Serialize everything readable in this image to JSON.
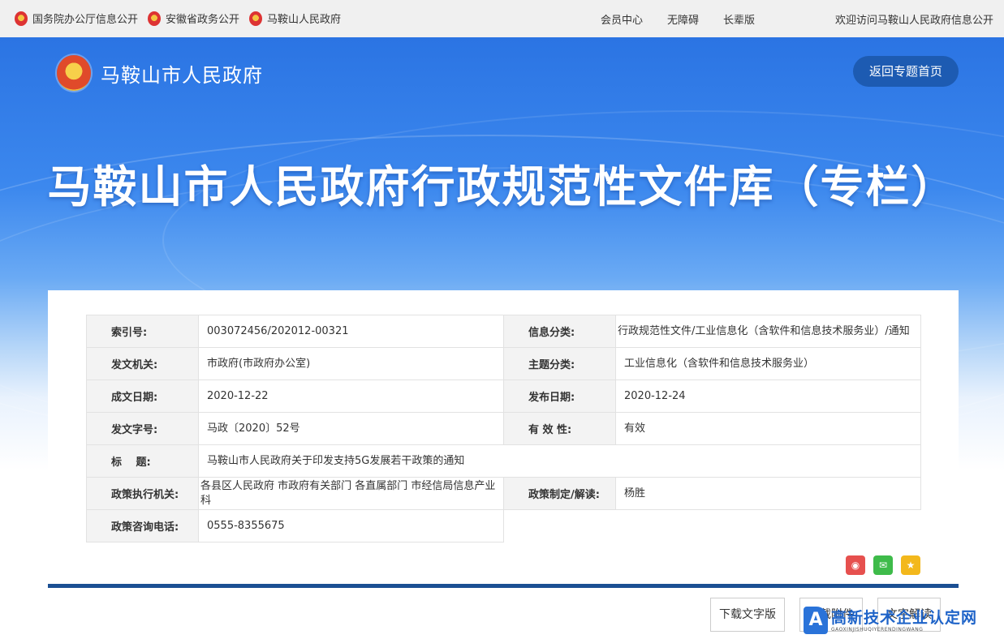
{
  "topbar": {
    "links": [
      "国务院办公厅信息公开",
      "安徽省政务公开",
      "马鞍山人民政府"
    ],
    "nav": [
      "会员中心",
      "无障碍",
      "长辈版"
    ],
    "welcome": "欢迎访问马鞍山人民政府信息公开"
  },
  "header": {
    "site_name": "马鞍山市人民政府",
    "back_button": "返回专题首页",
    "banner_title": "马鞍山市人民政府行政规范性文件库（专栏）"
  },
  "meta": {
    "index_label": "索引号:",
    "index_value": "003072456/202012-00321",
    "info_cat_label": "信息分类:",
    "info_cat_value": "行政规范性文件/工业信息化（含软件和信息技术服务业）/通知",
    "issuer_label": "发文机关:",
    "issuer_value": "市政府(市政府办公室)",
    "topic_label": "主题分类:",
    "topic_value": "工业信息化（含软件和信息技术服务业）",
    "written_label": "成文日期:",
    "written_value": "2020-12-22",
    "published_label": "发布日期:",
    "published_value": "2020-12-24",
    "docno_label": "发文字号:",
    "docno_value": "马政〔2020〕52号",
    "validity_label": "有 效 性:",
    "validity_value": "有效",
    "title_label": "标　 题:",
    "title_value": "马鞍山市人民政府关于印发支持5G发展若干政策的通知",
    "exec_label": "政策执行机关:",
    "exec_value": "各县区人民政府 市政府有关部门 各直属部门 市经信局信息产业科",
    "maker_label": "政策制定/解读:",
    "maker_value": "杨胜",
    "phone_label": "政策咨询电话:",
    "phone_value": "0555-8355675"
  },
  "share": {
    "weibo_icon": "weibo-icon",
    "wechat_icon": "wechat-icon",
    "favorite_icon": "favorite-icon"
  },
  "actions": [
    "下载文字版",
    "下载附件",
    "文字解读"
  ],
  "watermark": {
    "icon_letter": "A",
    "cn": "高新技术企业认定网",
    "en": "GAOXINJISHUQIYERENDINGWANG"
  }
}
